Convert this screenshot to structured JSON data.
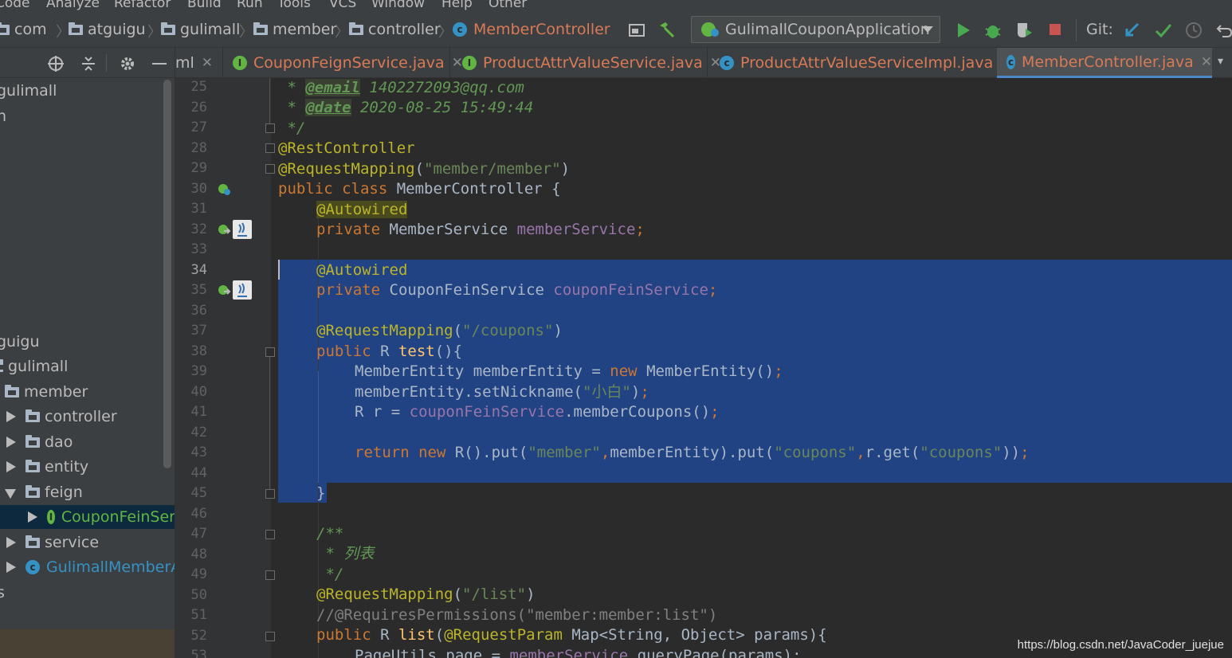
{
  "menu": [
    "Code",
    "Analyze",
    "Refactor",
    "Build",
    "Run",
    "Tools",
    "VCS",
    "Window",
    "Help",
    "Other"
  ],
  "breadcrumb": [
    "com",
    "atguigu",
    "gulimall",
    "member",
    "controller",
    "MemberController"
  ],
  "run_config": "GulimallCouponApplication",
  "git_label": "Git:",
  "tabs": [
    {
      "label": "ml",
      "type": "xml"
    },
    {
      "label": "CouponFeignService.java",
      "type": "interface"
    },
    {
      "label": "ProductAttrValueService.java",
      "type": "interface"
    },
    {
      "label": "ProductAttrValueServiceImpl.java",
      "type": "class"
    },
    {
      "label": "MemberController.java",
      "type": "class",
      "active": true
    }
  ],
  "tree": [
    {
      "label": "gulimall",
      "arrow": "",
      "icon": ""
    },
    {
      "label": "n",
      "arrow": "",
      "icon": ""
    },
    {
      "label": "guigu",
      "arrow": "",
      "icon": ""
    },
    {
      "label": "gulimall",
      "arrow": "",
      "icon": "folder"
    },
    {
      "label": "member",
      "arrow": "",
      "icon": "folder"
    },
    {
      "label": "controller",
      "arrow": "right",
      "icon": "folder"
    },
    {
      "label": "dao",
      "arrow": "right",
      "icon": "folder"
    },
    {
      "label": "entity",
      "arrow": "right",
      "icon": "folder"
    },
    {
      "label": "feign",
      "arrow": "down",
      "icon": "folder"
    },
    {
      "label": "CouponFeinSer",
      "arrow": "right",
      "icon": "interface",
      "selected": true
    },
    {
      "label": "service",
      "arrow": "right",
      "icon": "folder"
    },
    {
      "label": "GulimallMemberA",
      "arrow": "right",
      "icon": "springboot"
    },
    {
      "label": "s",
      "arrow": "",
      "icon": ""
    }
  ],
  "line_numbers": [
    "25",
    "26",
    "27",
    "28",
    "29",
    "30",
    "31",
    "32",
    "33",
    "34",
    "35",
    "36",
    "37",
    "38",
    "39",
    "40",
    "41",
    "42",
    "43",
    "44",
    "45",
    "46",
    "47",
    "48",
    "49",
    "50",
    "51",
    "52",
    "53"
  ],
  "current_line": "34",
  "code": {
    "l25_star": " * ",
    "l25_tag": "@email",
    "l25_text": " 1402272093@qq.com",
    "l26_star": " * ",
    "l26_tag": "@date",
    "l26_text": " 2020-08-25 15:49:44",
    "l27": " */",
    "l28": "@RestController",
    "l29_ann": "@RequestMapping",
    "l29_p1": "(",
    "l29_str": "\"member/member\"",
    "l29_p2": ")",
    "l30_kw": "public class ",
    "l30_rest": "MemberController {",
    "l31": "@Autowired",
    "l32_kw": "private ",
    "l32_type": "MemberService ",
    "l32_field": "memberService",
    "l32_semi": ";",
    "l34": "@Autowired",
    "l35_kw": "private ",
    "l35_type": "CouponFeinService ",
    "l35_field": "couponFeinService",
    "l35_semi": ";",
    "l37_ann": "@RequestMapping",
    "l37_p1": "(",
    "l37_str": "\"/coupons\"",
    "l37_p2": ")",
    "l38_kw": "public ",
    "l38_type": "R ",
    "l38_fn": "test",
    "l38_rest": "(){",
    "l39_a": "MemberEntity memberEntity = ",
    "l39_kw": "new ",
    "l39_b": "MemberEntity()",
    "l39_semi": ";",
    "l40_a": "memberEntity.setNickname(",
    "l40_str": "\"小白\"",
    "l40_b": ")",
    "l40_semi": ";",
    "l41_a": "R r = ",
    "l41_field": "couponFeinService",
    "l41_b": ".memberCoupons()",
    "l41_semi": ";",
    "l43_kw1": "return ",
    "l43_kw2": "new ",
    "l43_a": "R().put(",
    "l43_s1": "\"member\"",
    "l43_c1": ",",
    "l43_b": "memberEntity).put(",
    "l43_s2": "\"coupons\"",
    "l43_c2": ",",
    "l43_c": "r.get(",
    "l43_s3": "\"coupons\"",
    "l43_d": "))",
    "l43_semi": ";",
    "l45": "}",
    "l47": "/**",
    "l48": " * 列表",
    "l49": " */",
    "l50_ann": "@RequestMapping",
    "l50_p1": "(",
    "l50_str": "\"/list\"",
    "l50_p2": ")",
    "l51": "//@RequiresPermissions(\"member:member:list\")",
    "l52_kw": "public ",
    "l52_type": "R ",
    "l52_fn": "list",
    "l52_p": "(",
    "l52_ann": "@RequestParam",
    "l52_rest": " Map<String, Object> params){",
    "l53_a": "PageUtils page = ",
    "l53_field": "memberService",
    "l53_b": ".queryPage(params);"
  },
  "watermark": "https://blog.csdn.net/JavaCoder_juejue",
  "colors": {
    "keyword": "#cc7832",
    "annotation": "#bbb529",
    "string": "#6a8759",
    "field": "#9876aa",
    "selection": "#214283",
    "tab_text": "#d87a56"
  }
}
